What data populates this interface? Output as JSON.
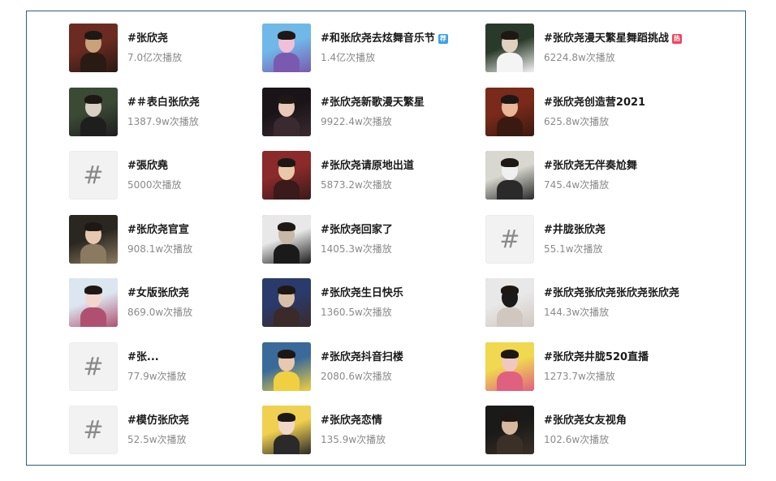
{
  "columns": [
    {
      "items": [
        {
          "title": "#张欣尧",
          "plays": "7.0亿次播放",
          "thumb": "photo",
          "palette": [
            "#6b2b22",
            "#c9a27a",
            "#2a1a14"
          ]
        },
        {
          "title": "#＃表白张欣尧",
          "plays": "1387.9w次播放",
          "thumb": "photo",
          "palette": [
            "#3b4a35",
            "#d8d0c4",
            "#1e1e1e"
          ]
        },
        {
          "title": "#張欣堯",
          "plays": "5000次播放",
          "thumb": "hash"
        },
        {
          "title": "#张欣尧官宣",
          "plays": "908.1w次播放",
          "thumb": "photo",
          "palette": [
            "#2a2620",
            "#e6c7b0",
            "#8a7a60"
          ]
        },
        {
          "title": "#女版张欣尧",
          "plays": "869.0w次播放",
          "thumb": "photo",
          "palette": [
            "#dce6f0",
            "#f4d6d0",
            "#b05070"
          ]
        },
        {
          "title": "#张...",
          "plays": "77.9w次播放",
          "thumb": "hash"
        },
        {
          "title": "#模仿张欣尧",
          "plays": "52.5w次播放",
          "thumb": "hash"
        }
      ]
    },
    {
      "items": [
        {
          "title": "#和张欣尧去炫舞音乐节",
          "plays": "1.4亿次播放",
          "thumb": "photo",
          "badge": "rec",
          "badge_text": "荐",
          "palette": [
            "#6fb8e8",
            "#f0c0d8",
            "#7a5ab0"
          ]
        },
        {
          "title": "#张欣尧新歌漫天繁星",
          "plays": "9922.4w次播放",
          "thumb": "photo",
          "palette": [
            "#1a1418",
            "#e8c8b8",
            "#3a2a30"
          ]
        },
        {
          "title": "#张欣尧请原地出道",
          "plays": "5873.2w次播放",
          "thumb": "photo",
          "palette": [
            "#8a2a2a",
            "#e8c8a8",
            "#3a1a1a"
          ]
        },
        {
          "title": "#张欣尧回家了",
          "plays": "1405.3w次播放",
          "thumb": "photo",
          "palette": [
            "#e8e8e8",
            "#c8b8a8",
            "#1a1a1a"
          ]
        },
        {
          "title": "#张欣尧生日快乐",
          "plays": "1360.5w次播放",
          "thumb": "photo",
          "palette": [
            "#2a3a6a",
            "#d8c0a8",
            "#3a2a2a"
          ]
        },
        {
          "title": "#张欣尧抖音扫楼",
          "plays": "2080.6w次播放",
          "thumb": "photo",
          "palette": [
            "#3a6a9a",
            "#e8c8b0",
            "#f0d040"
          ]
        },
        {
          "title": "#张欣尧恋情",
          "plays": "135.9w次播放",
          "thumb": "photo",
          "palette": [
            "#f0d050",
            "#f0d8c8",
            "#2a2a2a"
          ]
        }
      ]
    },
    {
      "items": [
        {
          "title": "#张欣尧漫天繁星舞蹈挑战",
          "plays": "6224.8w次播放",
          "thumb": "photo",
          "badge": "hot",
          "badge_text": "热",
          "palette": [
            "#2a3a2a",
            "#e0d0c0",
            "#f4f4f4"
          ]
        },
        {
          "title": "#张欣尧创造营2021",
          "plays": "625.8w次播放",
          "thumb": "photo",
          "palette": [
            "#7a2a1a",
            "#e8b898",
            "#3a1a10"
          ]
        },
        {
          "title": "#张欣尧无伴奏尬舞",
          "plays": "745.4w次播放",
          "thumb": "photo",
          "palette": [
            "#d8d8d0",
            "#f0f0f0",
            "#2a2a2a"
          ]
        },
        {
          "title": "#井胧张欣尧",
          "plays": "55.1w次播放",
          "thumb": "hash"
        },
        {
          "title": "#张欣尧张欣尧张欣尧张欣尧",
          "plays": "144.3w次播放",
          "thumb": "photo",
          "palette": [
            "#e8e8e8",
            "#1a1a1a",
            "#d0c8c0"
          ]
        },
        {
          "title": "#张欣尧井胧520直播",
          "plays": "1273.7w次播放",
          "thumb": "photo",
          "palette": [
            "#f0d850",
            "#f0c8c0",
            "#e06080"
          ]
        },
        {
          "title": "#张欣尧女友视角",
          "plays": "102.6w次播放",
          "thumb": "photo",
          "palette": [
            "#1a1a18",
            "#d8b8a0",
            "#3a3028"
          ]
        }
      ]
    }
  ],
  "hash_symbol": "#"
}
